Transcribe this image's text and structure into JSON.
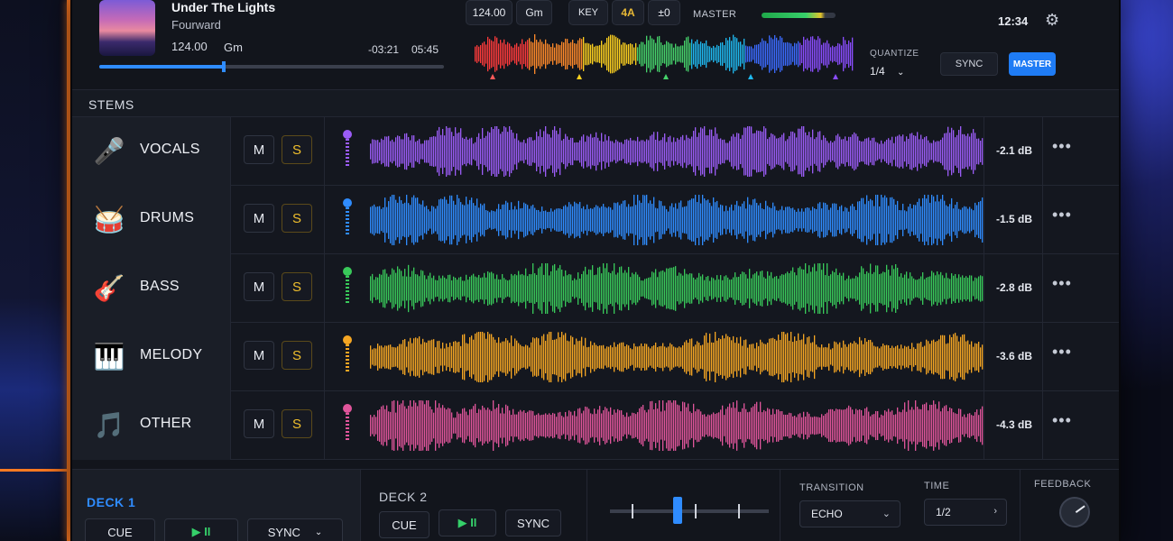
{
  "track": {
    "title": "Under The Lights",
    "artist": "Fourward",
    "bpm": "124.00",
    "key": "Gm",
    "remaining": "-03:21",
    "total": "05:45",
    "progress": 0.36
  },
  "center": {
    "bpm": "124.00",
    "key_name": "Gm",
    "key_label": "KEY",
    "camelot": "4A",
    "pitch": "±0",
    "master_label": "MASTER"
  },
  "right": {
    "time": "12:34",
    "quantize_label": "QUANTIZE",
    "quantize_value": "1/4",
    "sync_label": "SYNC",
    "master_label": "MASTER"
  },
  "stems_header": "STEMS",
  "stems": [
    {
      "name": "VOCALS",
      "icon": "microphone-icon",
      "glyph": "🎤",
      "color": "#9b5cf6",
      "db": "-2.1 dB",
      "mute": "M",
      "solo": "S"
    },
    {
      "name": "DRUMS",
      "icon": "drum-kit-icon",
      "glyph": "🥁",
      "color": "#2f8cff",
      "db": "-1.5 dB",
      "mute": "M",
      "solo": "S"
    },
    {
      "name": "BASS",
      "icon": "guitar-icon",
      "glyph": "🎸",
      "color": "#39c95a",
      "db": "-2.8 dB",
      "mute": "M",
      "solo": "S"
    },
    {
      "name": "MELODY",
      "icon": "piano-keys-icon",
      "glyph": "🎹",
      "color": "#f5a623",
      "db": "-3.6 dB",
      "mute": "M",
      "solo": "S"
    },
    {
      "name": "OTHER",
      "icon": "music-note-icon",
      "glyph": "🎵",
      "color": "#e0559b",
      "db": "-4.3 dB",
      "mute": "M",
      "solo": "S"
    }
  ],
  "more_label": "•••",
  "deck1": {
    "title": "DECK 1",
    "cue": "CUE",
    "play": "▶ II",
    "sync": "SYNC"
  },
  "deck2": {
    "title": "DECK 2",
    "cue": "CUE",
    "play": "▶ II",
    "sync": "SYNC"
  },
  "transition": {
    "label": "TRANSITION",
    "value": "ECHO"
  },
  "time": {
    "label": "TIME",
    "value": "1/2"
  },
  "feedback": {
    "label": "FEEDBACK",
    "knob_value": 0.7
  }
}
